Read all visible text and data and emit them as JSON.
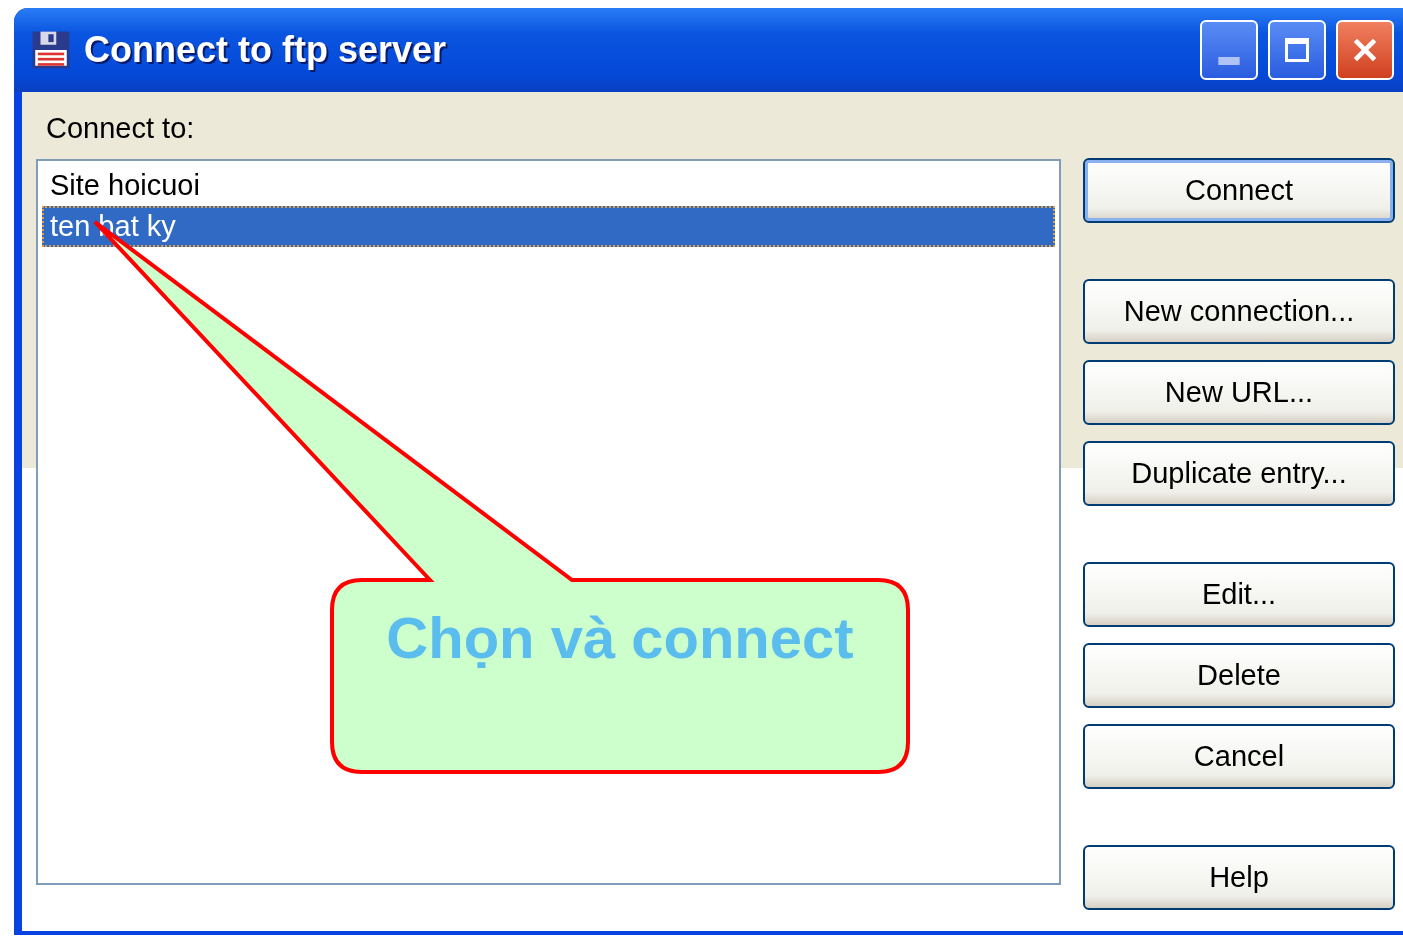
{
  "window": {
    "title": "Connect to ftp server"
  },
  "connect_label": "Connect to:",
  "sites": [
    {
      "label": "Site hoicuoi",
      "selected": false
    },
    {
      "label": "ten bat ky",
      "selected": true
    }
  ],
  "button_groups": [
    [
      {
        "label": "Connect",
        "default": true
      }
    ],
    [
      {
        "label": "New connection...",
        "default": false
      },
      {
        "label": "New URL...",
        "default": false
      },
      {
        "label": "Duplicate entry...",
        "default": false
      }
    ],
    [
      {
        "label": "Edit...",
        "default": false
      },
      {
        "label": "Delete",
        "default": false
      },
      {
        "label": "Cancel",
        "default": false
      }
    ],
    [
      {
        "label": "Help",
        "default": false
      }
    ]
  ],
  "callout": {
    "text": "Chọn và connect"
  }
}
